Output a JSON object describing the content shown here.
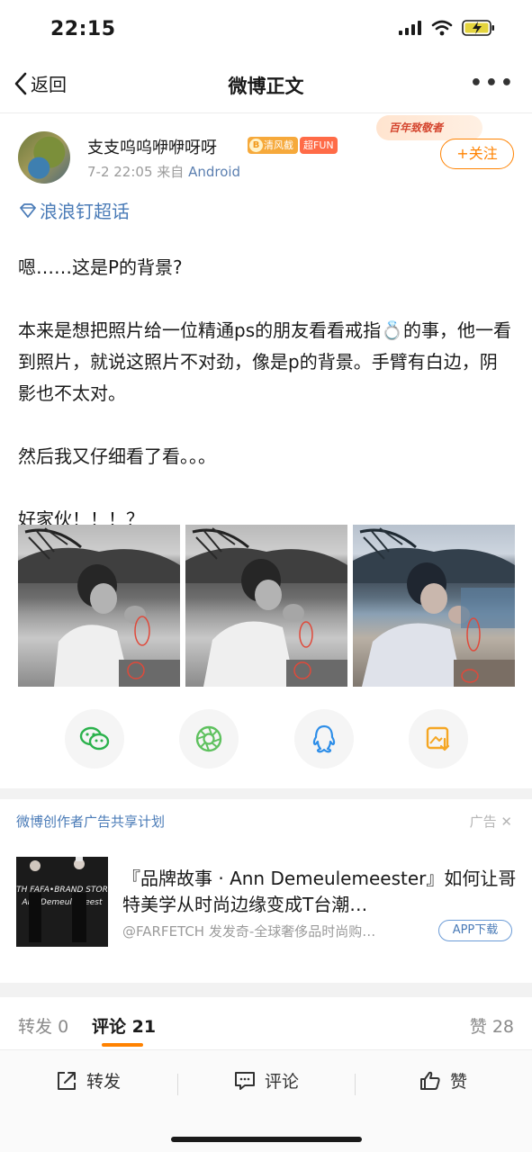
{
  "status_bar": {
    "time": "22:15"
  },
  "nav": {
    "back_label": "返回",
    "title": "微博正文",
    "more_label": "•••"
  },
  "author": {
    "name": "支支呜呜咿咿呀呀",
    "badge_level": "清风截",
    "badge_fun": "超FUN",
    "time": "7-2 22:05",
    "source_prefix": "来自",
    "source": "Android",
    "promo": "百年致敬者",
    "follow_label": "+关注"
  },
  "topic": {
    "label": "浪浪钉超话"
  },
  "post": {
    "p1": "嗯……这是P的背景?",
    "p2": "本来是想把照片给一位精通ps的朋友看看戒指💍的事，他一看到照片，就说这照片不对劲，像是p的背景。手臂有白边，阴影也不太对。",
    "p3": "然后我又仔细看了看。。。",
    "p4": "好家伙！！！？"
  },
  "share": {
    "icons": [
      "wechat-icon",
      "moments-icon",
      "qq-icon",
      "save-image-icon"
    ]
  },
  "ad": {
    "label": "微博创作者广告共享计划",
    "tag": "广告",
    "thumb_text": "TH FAFA•BRAND STOR",
    "thumb_text2": "Ann Demeulemeest",
    "title": "『品牌故事 · Ann Demeulemeester』如何让哥特美学从时尚边缘变成T台潮…",
    "subtitle": "@FARFETCH 发发奇-全球奢侈品时尚购…",
    "button": "APP下载"
  },
  "tabs": {
    "repost_label": "转发",
    "repost_count": "0",
    "comment_label": "评论",
    "comment_count": "21",
    "like_label": "赞",
    "like_count": "28"
  },
  "actions": {
    "repost": "转发",
    "comment": "评论",
    "like": "赞"
  },
  "colors": {
    "accent": "#ff8200",
    "link": "#4a7bb7",
    "annotation": "#e0493a"
  }
}
